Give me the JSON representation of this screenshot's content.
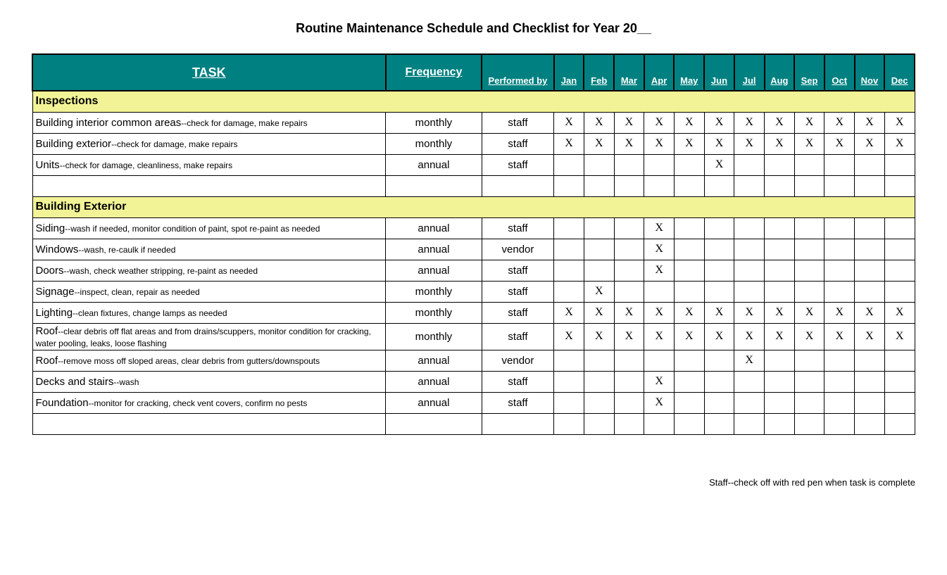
{
  "title": "Routine Maintenance Schedule and Checklist for Year 20__",
  "headers": {
    "task": "TASK",
    "frequency": "Frequency",
    "performed_by": "Performed by",
    "months": [
      "Jan",
      "Feb",
      "Mar",
      "Apr",
      "May",
      "Jun",
      "Jul",
      "Aug",
      "Sep",
      "Oct",
      "Nov",
      "Dec"
    ]
  },
  "sections": [
    {
      "name": "Inspections",
      "rows": [
        {
          "task_main": "Building interior common areas",
          "task_sub": "--check for damage, make repairs",
          "frequency": "monthly",
          "performed_by": "staff",
          "months": [
            "X",
            "X",
            "X",
            "X",
            "X",
            "X",
            "X",
            "X",
            "X",
            "X",
            "X",
            "X"
          ]
        },
        {
          "task_main": "Building exterior",
          "task_sub": "--check for damage, make repairs",
          "frequency": "monthly",
          "performed_by": "staff",
          "months": [
            "X",
            "X",
            "X",
            "X",
            "X",
            "X",
            "X",
            "X",
            "X",
            "X",
            "X",
            "X"
          ]
        },
        {
          "task_main": "Units",
          "task_sub": "--check for damage, cleanliness, make repairs",
          "frequency": "annual",
          "performed_by": "staff",
          "months": [
            "",
            "",
            "",
            "",
            "",
            "X",
            "",
            "",
            "",
            "",
            "",
            ""
          ]
        },
        {
          "task_main": "",
          "task_sub": "",
          "frequency": "",
          "performed_by": "",
          "months": [
            "",
            "",
            "",
            "",
            "",
            "",
            "",
            "",
            "",
            "",
            "",
            ""
          ]
        }
      ]
    },
    {
      "name": "Building Exterior",
      "rows": [
        {
          "task_main": "Siding",
          "task_sub": "--wash if needed, monitor condition of paint, spot re-paint as needed",
          "frequency": "annual",
          "performed_by": "staff",
          "months": [
            "",
            "",
            "",
            "X",
            "",
            "",
            "",
            "",
            "",
            "",
            "",
            ""
          ]
        },
        {
          "task_main": "Windows",
          "task_sub": "--wash, re-caulk if needed",
          "frequency": "annual",
          "performed_by": "vendor",
          "months": [
            "",
            "",
            "",
            "X",
            "",
            "",
            "",
            "",
            "",
            "",
            "",
            ""
          ]
        },
        {
          "task_main": "Doors",
          "task_sub": "--wash, check weather stripping, re-paint as needed",
          "frequency": "annual",
          "performed_by": "staff",
          "months": [
            "",
            "",
            "",
            "X",
            "",
            "",
            "",
            "",
            "",
            "",
            "",
            ""
          ]
        },
        {
          "task_main": "Signage",
          "task_sub": "--inspect, clean, repair as needed",
          "frequency": "monthly",
          "performed_by": "staff",
          "months": [
            "",
            "X",
            "",
            "",
            "",
            "",
            "",
            "",
            "",
            "",
            "",
            ""
          ]
        },
        {
          "task_main": "Lighting",
          "task_sub": "--clean fixtures, change lamps as needed",
          "frequency": "monthly",
          "performed_by": "staff",
          "months": [
            "X",
            "X",
            "X",
            "X",
            "X",
            "X",
            "X",
            "X",
            "X",
            "X",
            "X",
            "X"
          ]
        },
        {
          "task_main": "Roof",
          "task_sub": "--clear debris off flat areas and from drains/scuppers, monitor condition for cracking, water pooling, leaks, loose flashing",
          "frequency": "monthly",
          "performed_by": "staff",
          "months": [
            "X",
            "X",
            "X",
            "X",
            "X",
            "X",
            "X",
            "X",
            "X",
            "X",
            "X",
            "X"
          ]
        },
        {
          "task_main": "Roof",
          "task_sub": "--remove moss off sloped areas, clear debris from gutters/downspouts",
          "frequency": "annual",
          "performed_by": "vendor",
          "months": [
            "",
            "",
            "",
            "",
            "",
            "",
            "X",
            "",
            "",
            "",
            "",
            ""
          ]
        },
        {
          "task_main": "Decks and stairs",
          "task_sub": "--wash",
          "frequency": "annual",
          "performed_by": "staff",
          "months": [
            "",
            "",
            "",
            "X",
            "",
            "",
            "",
            "",
            "",
            "",
            "",
            ""
          ]
        },
        {
          "task_main": "Foundation",
          "task_sub": "--monitor for cracking, check vent covers, confirm no pests",
          "frequency": "annual",
          "performed_by": "staff",
          "months": [
            "",
            "",
            "",
            "X",
            "",
            "",
            "",
            "",
            "",
            "",
            "",
            ""
          ]
        },
        {
          "task_main": "",
          "task_sub": "",
          "frequency": "",
          "performed_by": "",
          "months": [
            "",
            "",
            "",
            "",
            "",
            "",
            "",
            "",
            "",
            "",
            "",
            ""
          ]
        }
      ]
    }
  ],
  "footnote": "Staff--check off with red pen when task is complete"
}
